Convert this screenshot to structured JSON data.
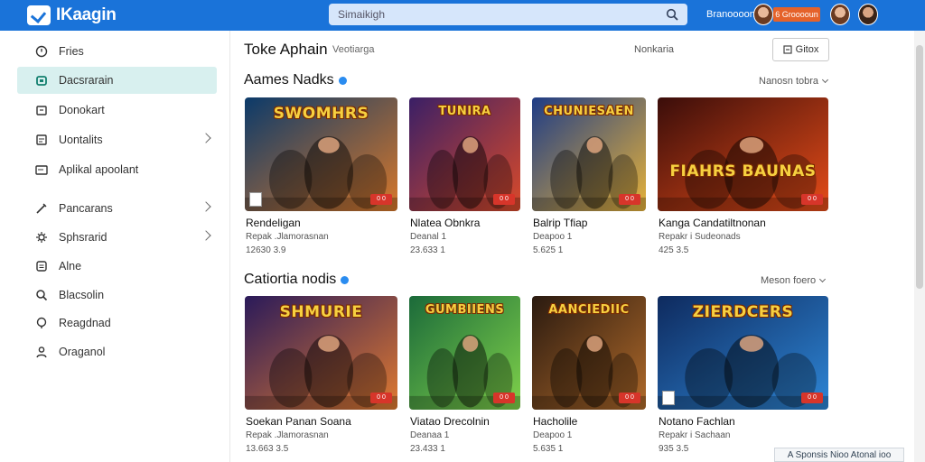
{
  "app": {
    "name": "IKaagin"
  },
  "search": {
    "placeholder": "Simaikigh"
  },
  "user": {
    "name": "Branoooon",
    "points": "6 Grooooun"
  },
  "sidebar": {
    "items": [
      {
        "label": "Fries",
        "icon": "clock-icon"
      },
      {
        "label": "Dacsrarain",
        "icon": "home-icon",
        "active": true
      },
      {
        "label": "Donokart",
        "icon": "calendar-icon"
      },
      {
        "label": "Uontalits",
        "icon": "list-icon",
        "chevron": true
      },
      {
        "label": "Aplikal apoolant",
        "icon": "card-icon"
      },
      {
        "label": "Pancarans",
        "icon": "pen-icon",
        "chevron": true
      },
      {
        "label": "Sphsrarid",
        "icon": "gear-icon",
        "chevron": true
      },
      {
        "label": "Alne",
        "icon": "box-icon"
      },
      {
        "label": "Blacsolin",
        "icon": "search-icon"
      },
      {
        "label": "Reagdnad",
        "icon": "bulb-icon"
      },
      {
        "label": "Oraganol",
        "icon": "user-icon"
      }
    ]
  },
  "header": {
    "title": "Toke Aphain",
    "subtitle": "Veotiarga",
    "link": "Nonkaria",
    "button": "Gitox"
  },
  "sections": [
    {
      "title": "Aames Nadks",
      "more": "Nanosn tobra",
      "games": [
        {
          "thumb_title": "SWOMHRS",
          "name": "Rendeligan",
          "developer": "Repak .Jlamorasnan",
          "stats": "12630 3.9",
          "badge": "0 0",
          "palette": [
            "#0b3a6a",
            "#d8782a"
          ],
          "corner": true
        },
        {
          "thumb_title": "TUNIRA",
          "name": "Nlatea Obnkra",
          "developer": "Deanal 1",
          "stats": "23.633 1",
          "badge": "0 0",
          "palette": [
            "#3a1f66",
            "#d94a2a"
          ],
          "corner": false
        },
        {
          "thumb_title": "CHUNIESAEN",
          "name": "Balrip Tfiap",
          "developer": "Deapoo 1",
          "stats": "5.625 1",
          "badge": "0 0",
          "palette": [
            "#1e3c86",
            "#e6b23a"
          ],
          "corner": false
        },
        {
          "thumb_title": "FIAHRS BAUNAS",
          "name": "Kanga Candatiltnonan",
          "developer": "Repakr i Sudeonads",
          "stats": "425 3.5",
          "badge": "0 0",
          "palette": [
            "#3a0d0a",
            "#e64c18"
          ],
          "corner": false
        }
      ]
    },
    {
      "title": "Catiortia nodis",
      "more": "Meson foero",
      "games": [
        {
          "thumb_title": "SHMURIE",
          "name": "Soekan Panan Soana",
          "developer": "Repak .Jlamorasnan",
          "stats": "13.663 3.5",
          "badge": "0 0",
          "palette": [
            "#2a1a5a",
            "#e07a30"
          ],
          "corner": false
        },
        {
          "thumb_title": "GUMBIIENS",
          "name": "Viatao Drecolnin",
          "developer": "Deanaa 1",
          "stats": "23.433 1",
          "badge": "0 0",
          "palette": [
            "#1b6a3a",
            "#7fd14a"
          ],
          "corner": false
        },
        {
          "thumb_title": "AANCIEDIIC",
          "name": "Hacholile",
          "developer": "Deapoo 1",
          "stats": "5.635 1",
          "badge": "0 0",
          "palette": [
            "#2a1a10",
            "#b06a2a"
          ],
          "corner": false
        },
        {
          "thumb_title": "ZIERDCERS",
          "name": "Notano Fachlan",
          "developer": "Repakr i Sachaan",
          "stats": "935 3.5",
          "badge": "0 0",
          "palette": [
            "#0e2a5e",
            "#2e86d6"
          ],
          "corner": true
        }
      ]
    }
  ],
  "toast": "A Sponsis Nioo Atonal ioo"
}
